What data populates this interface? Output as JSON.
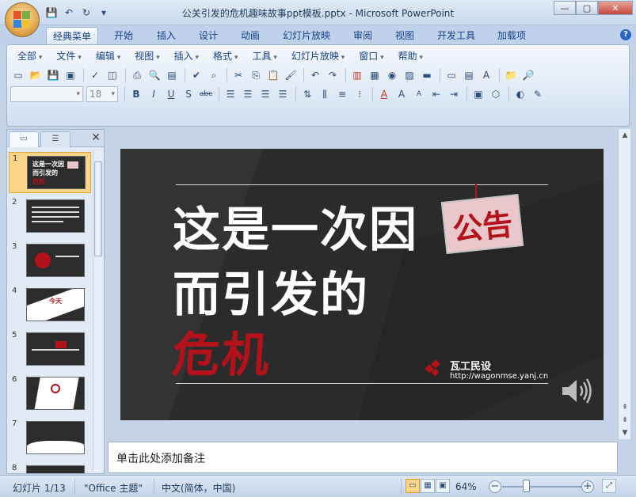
{
  "window": {
    "title": "公关引发的危机趣味故事ppt模板.pptx - Microsoft PowerPoint",
    "controls": {
      "minimize": "—",
      "maximize": "▢",
      "close": "✕"
    }
  },
  "quick_access": {
    "save": "💾",
    "undo": "↶",
    "redo": "↻",
    "customize": "▾"
  },
  "tabs": [
    {
      "label": "经典菜单",
      "active": true
    },
    {
      "label": "开始"
    },
    {
      "label": "插入"
    },
    {
      "label": "设计"
    },
    {
      "label": "动画"
    },
    {
      "label": "幻灯片放映"
    },
    {
      "label": "审阅"
    },
    {
      "label": "视图"
    },
    {
      "label": "开发工具"
    },
    {
      "label": "加载项"
    }
  ],
  "help": "?",
  "menu": [
    "全部",
    "文件",
    "编辑",
    "视图",
    "插入",
    "格式",
    "工具",
    "幻灯片放映",
    "窗口",
    "帮助"
  ],
  "format": {
    "font_size": "18"
  },
  "toolbar1_icons": [
    "new-icon",
    "open-icon",
    "save-icon",
    "permission-icon",
    "spell-icon",
    "print-preview-icon",
    "cut-icon",
    "copy-icon",
    "paste-icon",
    "format-painter-icon",
    "undo-icon",
    "redo-icon",
    "chart-icon",
    "table-icon",
    "hyperlink-icon",
    "picture-icon",
    "textbox-icon",
    "insert-slide-icon",
    "layout-icon",
    "shapes-icon",
    "find-icon"
  ],
  "toolbar2_labels": {
    "bold": "B",
    "italic": "I",
    "underline": "U",
    "shadow": "S",
    "strike": "abc",
    "font_color": "A",
    "grow": "A",
    "shrink": "A"
  },
  "side_panel": {
    "slides": [
      {
        "num": "1",
        "selected": true
      },
      {
        "num": "2"
      },
      {
        "num": "3"
      },
      {
        "num": "4"
      },
      {
        "num": "5"
      },
      {
        "num": "6"
      },
      {
        "num": "7"
      },
      {
        "num": "8"
      }
    ],
    "close": "✕"
  },
  "slide": {
    "line1": "这是一次因",
    "notice": "公告",
    "line2": "而引发的",
    "line3": "危机",
    "brand": "瓦工民设",
    "url": "http://wagonmse.yanj.cn"
  },
  "thumb_texts": {
    "s1a": "这是一次因",
    "s1b": "而引发的",
    "s1c": "危机",
    "s4": "今天"
  },
  "notes": {
    "placeholder": "单击此处添加备注"
  },
  "status": {
    "slide_indicator": "幻灯片 1/13",
    "theme": "\"Office 主题\"",
    "language": "中文(简体，中国)",
    "zoom": "64%",
    "zoom_fraction": 0.64
  },
  "colors": {
    "accent_red": "#b4121a",
    "slide_bg": "#2b2b2b",
    "ribbon": "#dce7f5"
  }
}
